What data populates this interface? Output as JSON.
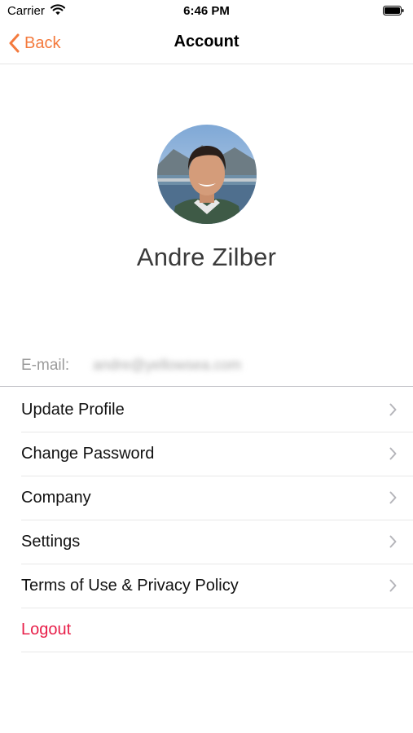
{
  "status_bar": {
    "carrier": "Carrier",
    "time": "6:46 PM"
  },
  "nav": {
    "back_label": "Back",
    "title": "Account"
  },
  "profile": {
    "name": "Andre Zilber",
    "email_label": "E-mail:",
    "email_value": "andre@yellowsea.com"
  },
  "menu": {
    "items": [
      {
        "label": "Update Profile"
      },
      {
        "label": "Change Password"
      },
      {
        "label": "Company"
      },
      {
        "label": "Settings"
      },
      {
        "label": "Terms of Use & Privacy Policy"
      }
    ],
    "logout_label": "Logout"
  },
  "colors": {
    "accent": "#f47a3d",
    "logout": "#e8204a"
  },
  "icons": [
    "wifi-icon",
    "battery-icon",
    "chevron-left-icon",
    "chevron-right-icon"
  ]
}
